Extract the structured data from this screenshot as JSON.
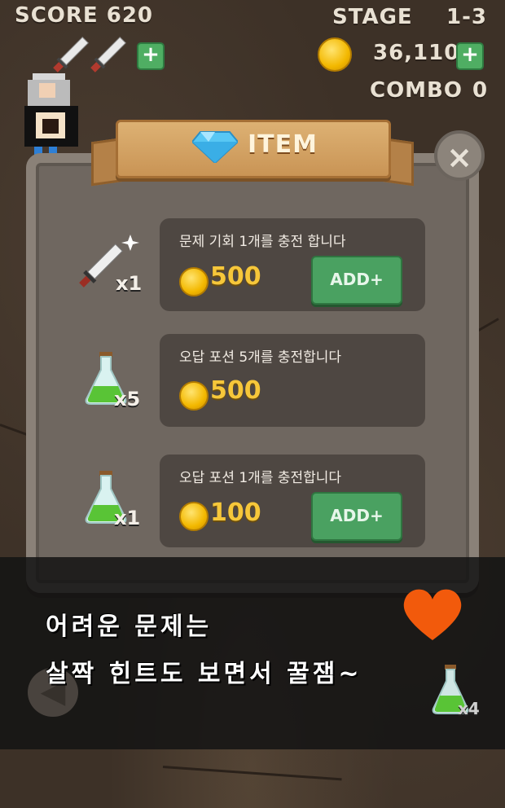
{
  "hud": {
    "score": "SCORE 620",
    "stage_label": "STAGE",
    "stage_value": "1-3",
    "coins": "36,110",
    "combo_label": "COMBO",
    "combo_value": "0",
    "plus": "+"
  },
  "panel": {
    "title": "ITEM",
    "close": "×",
    "items": [
      {
        "icon": "sword-icon",
        "qty": "x1",
        "description": "문제 기회 1개를 충전 합니다",
        "price": "500",
        "button": "ADD+"
      },
      {
        "icon": "potion-icon",
        "qty": "x5",
        "description": "오답 포션 5개를 충전합니다",
        "price": "500",
        "button": ""
      },
      {
        "icon": "potion-icon",
        "qty": "x1",
        "description": "오답 포션 1개를 충전합니다",
        "price": "100",
        "button": "ADD+"
      }
    ]
  },
  "overlay": {
    "line1": "어려운 문제는",
    "line2": "살짝 힌트도 보면서 꿀잼~",
    "potion_count": "x4"
  },
  "colors": {
    "accent_green": "#4aa161",
    "price_gold": "#f6c73a",
    "heart": "#f25a0c"
  }
}
